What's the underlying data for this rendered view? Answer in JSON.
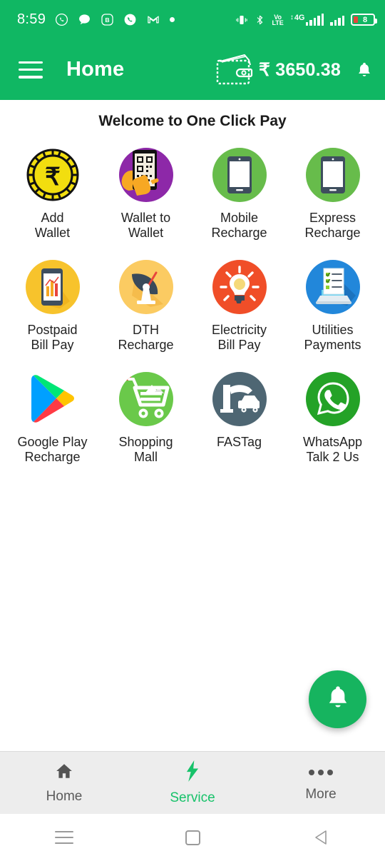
{
  "status_bar": {
    "time": "8:59",
    "left_icons": [
      "whatsapp-icon",
      "message-icon",
      "b-badge-icon",
      "phone-circle-icon",
      "gmail-icon",
      "dot-icon"
    ],
    "right_icons": [
      "vibrate-icon",
      "bluetooth-icon",
      "volte-icon",
      "4g-signal-icon",
      "signal-icon",
      "battery-icon"
    ],
    "volte_top": "Vo",
    "volte_bottom": "LTE",
    "network_label": "4G",
    "battery_level": "8"
  },
  "app_bar": {
    "menu_icon": "hamburger-menu-icon",
    "title": "Home",
    "wallet_icon": "wallet-icon",
    "balance": "₹ 3650.38",
    "notification_icon": "bell-icon"
  },
  "main": {
    "welcome_text": "Welcome to One Click Pay",
    "services": [
      {
        "label_line1": "Add",
        "label_line2": "Wallet",
        "icon": "rupee-coin-icon",
        "color": "#F2DE0F"
      },
      {
        "label_line1": "Wallet to",
        "label_line2": "Wallet",
        "icon": "qr-scan-phone-icon",
        "color": "#8D28A8"
      },
      {
        "label_line1": "Mobile",
        "label_line2": "Recharge",
        "icon": "smartphone-icon",
        "color": "#67BC4B"
      },
      {
        "label_line1": "Express",
        "label_line2": "Recharge",
        "icon": "smartphone-icon",
        "color": "#67BC4B"
      },
      {
        "label_line1": "Postpaid",
        "label_line2": "Bill Pay",
        "icon": "phone-bill-chart-icon",
        "color": "#F7C32C"
      },
      {
        "label_line1": "DTH",
        "label_line2": "Recharge",
        "icon": "satellite-dish-icon",
        "color": "#FBCB62"
      },
      {
        "label_line1": "Electricity",
        "label_line2": "Bill Pay",
        "icon": "light-bulb-icon",
        "color": "#F04E28"
      },
      {
        "label_line1": "Utilities",
        "label_line2": "Payments",
        "icon": "laptop-checklist-icon",
        "color": "#2287DA"
      },
      {
        "label_line1": "Google Play",
        "label_line2": "Recharge",
        "icon": "google-play-icon",
        "color": "#FFFFFF"
      },
      {
        "label_line1": "Shopping",
        "label_line2": "Mall",
        "icon": "shopping-cart-icon",
        "color": "#6AC94A"
      },
      {
        "label_line1": "FASTag",
        "label_line2": "",
        "icon": "toll-barrier-car-icon",
        "color": "#4E6673"
      },
      {
        "label_line1": "WhatsApp",
        "label_line2": "Talk 2 Us",
        "icon": "whatsapp-icon",
        "color": "#24A227"
      }
    ],
    "fab_icon": "bell-icon"
  },
  "bottom_nav": {
    "items": [
      {
        "label": "Home",
        "icon": "home-icon",
        "active": false
      },
      {
        "label": "Service",
        "icon": "lightning-icon",
        "active": true
      },
      {
        "label": "More",
        "icon": "more-dots-icon",
        "active": false
      }
    ]
  },
  "system_nav": {
    "recents_icon": "recents-icon",
    "home_icon": "home-square-icon",
    "back_icon": "back-triangle-icon"
  },
  "colors": {
    "brand_green": "#10B763",
    "accent_green": "#17C26A",
    "fab_green": "#16B45F",
    "nav_bg": "#EDEDED",
    "text_dark": "#232323"
  }
}
